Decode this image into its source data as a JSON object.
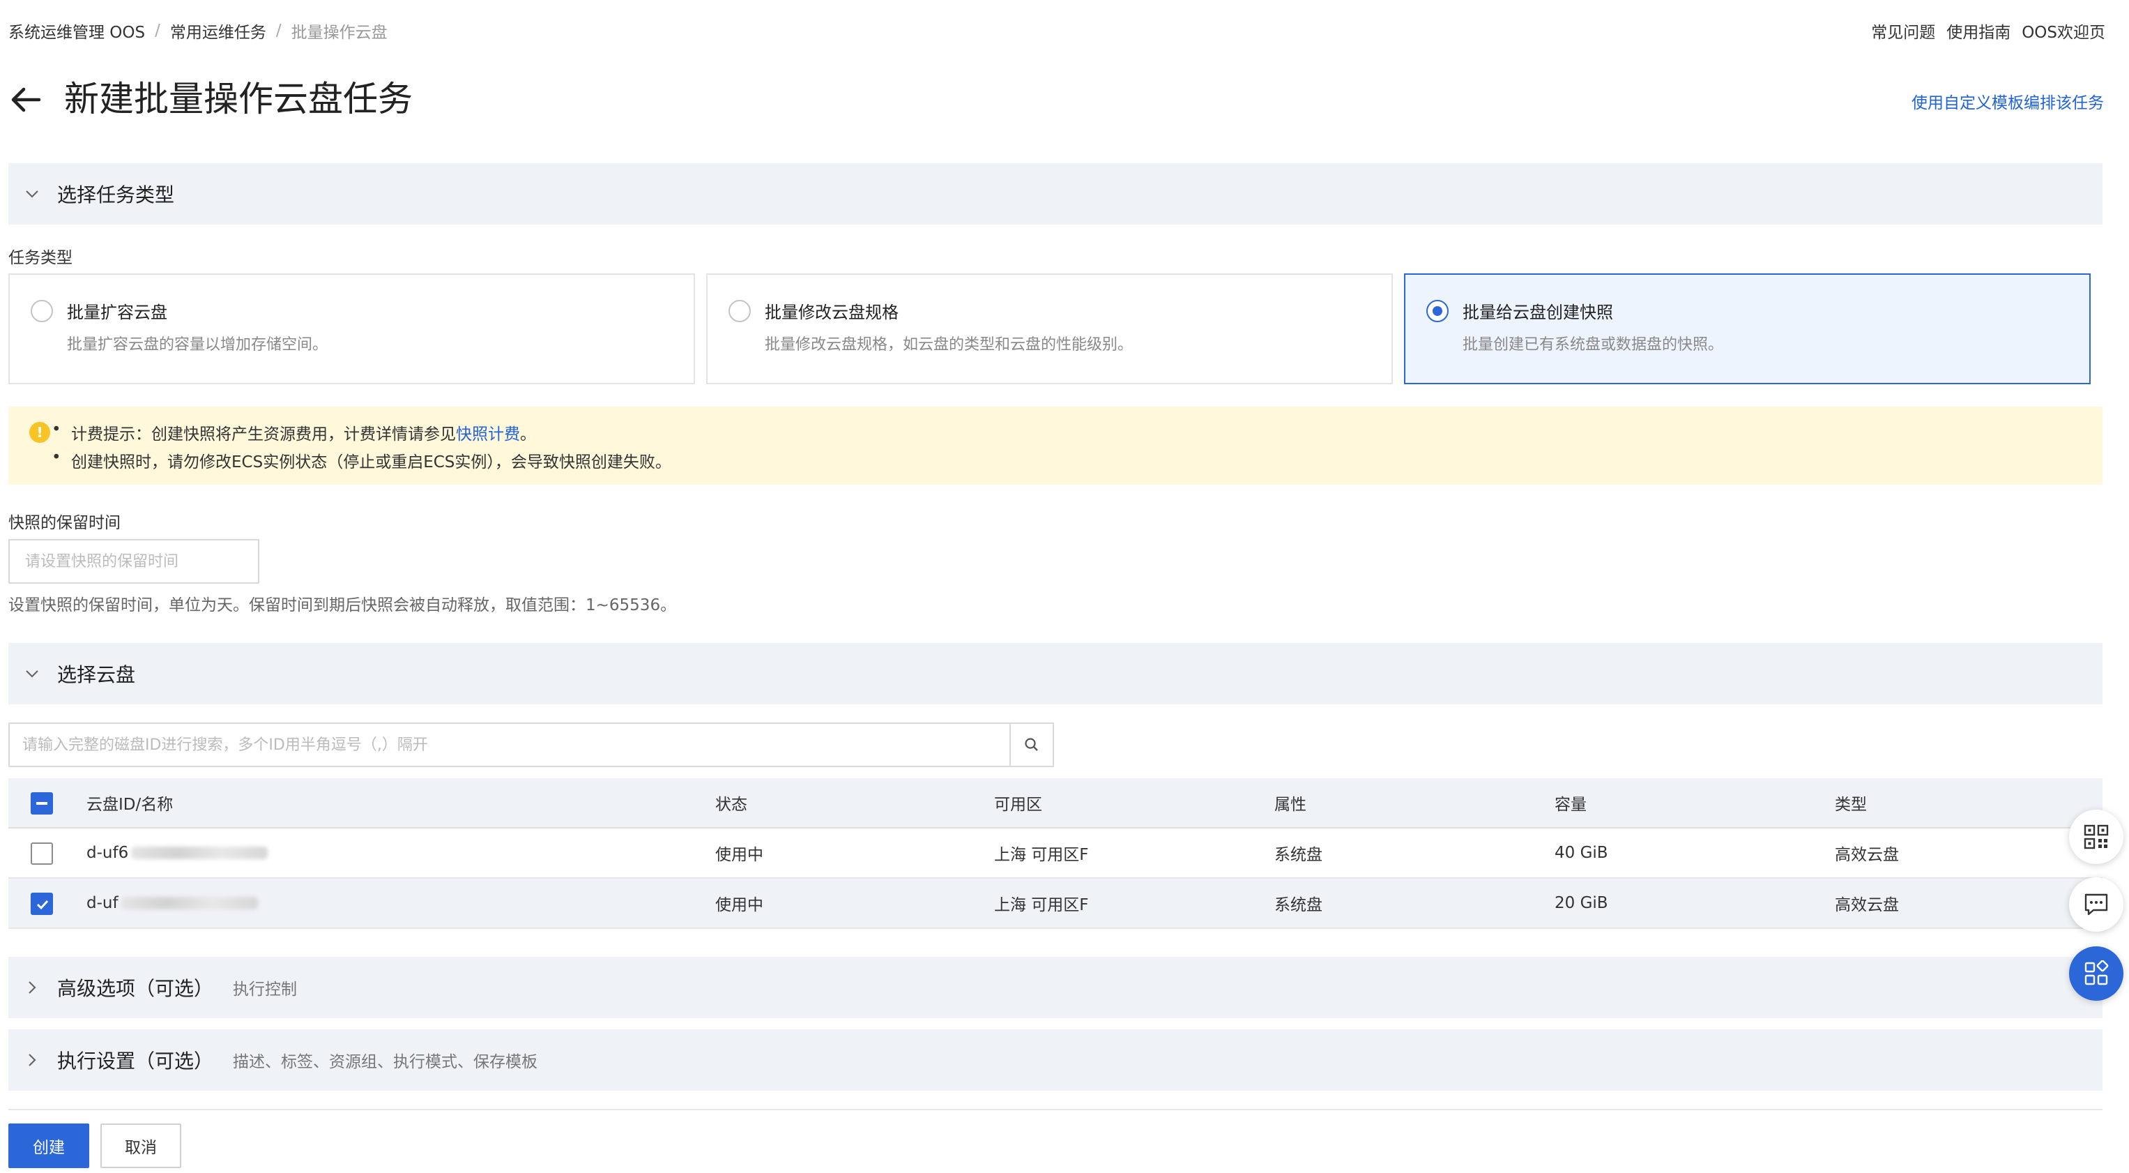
{
  "breadcrumb": {
    "items": [
      "系统运维管理 OOS",
      "常用运维任务",
      "批量操作云盘"
    ],
    "separator": "/"
  },
  "top_links": [
    "常见问题",
    "使用指南",
    "OOS欢迎页"
  ],
  "page": {
    "title": "新建批量操作云盘任务",
    "custom_template_link": "使用自定义模板编排该任务"
  },
  "section_task_type": {
    "title": "选择任务类型",
    "field_label": "任务类型",
    "cards": [
      {
        "title": "批量扩容云盘",
        "desc": "批量扩容云盘的容量以增加存储空间。",
        "selected": false
      },
      {
        "title": "批量修改云盘规格",
        "desc": "批量修改云盘规格，如云盘的类型和云盘的性能级别。",
        "selected": false
      },
      {
        "title": "批量给云盘创建快照",
        "desc": "批量创建已有系统盘或数据盘的快照。",
        "selected": true
      }
    ]
  },
  "notice": {
    "line1_prefix": "计费提示：创建快照将产生资源费用，计费详情请参见",
    "line1_link": "快照计费",
    "line1_suffix": "。",
    "line2": "创建快照时，请勿修改ECS实例状态（停止或重启ECS实例），会导致快照创建失败。"
  },
  "retention": {
    "label": "快照的保留时间",
    "placeholder": "请设置快照的保留时间",
    "help": "设置快照的保留时间，单位为天。保留时间到期后快照会被自动释放，取值范围：1~65536。"
  },
  "section_disks": {
    "title": "选择云盘",
    "search_placeholder": "请输入完整的磁盘ID进行搜索，多个ID用半角逗号（,）隔开"
  },
  "table": {
    "headers": [
      "云盘ID/名称",
      "状态",
      "可用区",
      "属性",
      "容量",
      "类型"
    ],
    "rows": [
      {
        "id": "d-uf6",
        "status": "使用中",
        "zone": "上海 可用区F",
        "attr": "系统盘",
        "size": "40 GiB",
        "type": "高效云盘",
        "checked": false
      },
      {
        "id": "d-uf",
        "status": "使用中",
        "zone": "上海 可用区F",
        "attr": "系统盘",
        "size": "20 GiB",
        "type": "高效云盘",
        "checked": true
      }
    ]
  },
  "section_advanced": {
    "title": "高级选项（可选）",
    "sub": "执行控制"
  },
  "section_exec": {
    "title": "执行设置（可选）",
    "sub": "描述、标签、资源组、执行模式、保存模板"
  },
  "footer": {
    "create": "创建",
    "cancel": "取消"
  },
  "icons": [
    "back-arrow-icon",
    "chevron-down-icon",
    "chevron-right-icon",
    "warning-icon",
    "search-icon",
    "qr-code-icon",
    "chat-icon",
    "apps-icon",
    "check-icon"
  ],
  "colors": {
    "primary": "#2b67d9",
    "section_bg": "#eff2f7",
    "notice_bg": "#fff8db",
    "link": "#1f63d6"
  }
}
